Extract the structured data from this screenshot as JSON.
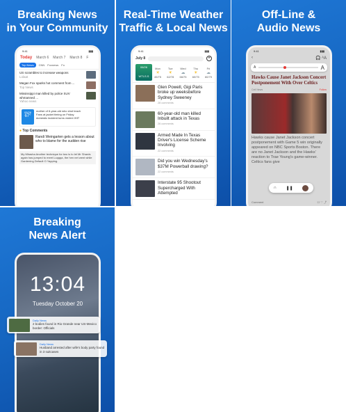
{
  "panels": {
    "p1": {
      "title_line1": "Breaking News",
      "title_line2": "in Your Community",
      "dates": [
        "Today",
        "March 6",
        "March 7",
        "March 8",
        "F"
      ],
      "sources": [
        "Top News",
        "CNN",
        "Foxnews",
        "Fo"
      ],
      "news": [
        {
          "title": "US scrambles to increase weapons",
          "meta": "Lolaat"
        },
        {
          "title": "Megan Fox sparks hot comment from ...",
          "meta": "Top News"
        },
        {
          "title": "Mississippi man killed by police SUV whmanned ...",
          "meta": "Yahoo news"
        }
      ],
      "weather_bullets": [
        "mother of 6-year-old who shot teach",
        "Fans at jacket timing on Friday",
        "domestic incident turns violent IHIT"
      ],
      "weather_card": {
        "date": "05/26",
        "temp": "67°"
      },
      "top_comments_label": "Top Comments",
      "comment_title": "Randi Weingarten gets a lesson about who to blame for the sudden rise",
      "quote": "My Mhasha Another technique for two is to let Mr Shards again has jumped to meet Luqqqa, the hen net went while Gardening Default O Yapping."
    },
    "p2": {
      "title_line1": "Real-Time Weather",
      "title_line2": "Traffic & Local News",
      "date": "July 8",
      "weather_card": {
        "date": "06/26",
        "label": "WTLS.S"
      },
      "days": [
        "Mon",
        "Tue",
        "Wed",
        "Thu",
        "Fri"
      ],
      "temps": [
        "45/75",
        "62/78",
        "66/75",
        "60/75",
        "60/79"
      ],
      "news": [
        {
          "title": "Glen Powell, Gigi Paris broke up weeksbefore Sydney Sweeney",
          "meta": "28 comments"
        },
        {
          "title": "60-year-old man killed Inbuilt attack in Texas",
          "meta": "26 comments"
        },
        {
          "title": "Armed Made In Texas Driver's License Scheme Involving",
          "meta": "22 comments"
        },
        {
          "title": "Did you win Wednesday's $37M Powerball drawing?",
          "meta": "22 comments"
        },
        {
          "title": "Interstate 95 Shootout Supercharged With Attempted",
          "meta": ""
        }
      ]
    },
    "p3": {
      "title_line1": "Off-Line &",
      "title_line2": "Audio News",
      "font_small": "A",
      "font_large": "A",
      "headline": "Hawks Cause Janet Jackson Concert Postponement With Over Celtics",
      "byline": "Cell News",
      "follow": "Follow",
      "body": "Hawks cause Janet Jackson concert postponement with Game 5 win originally appeared on NBC Sports Boston. There are no Janet Jackson and the Hawks' reaction to Trae Young's game-winner. Celtics fans give",
      "footer_comment": "Comment"
    },
    "p4": {
      "title_line1": "Breaking",
      "title_line2": "News Alert",
      "time": "13:04",
      "date": "Tuesday October 20",
      "notifications": [
        {
          "app": "Daily News",
          "text": "2 bodies found in Rio Grande near US-Mexico border: Officials"
        },
        {
          "app": "Daily News",
          "text": "Husband arrested after wife's body party found in 3 suitcases"
        }
      ]
    }
  },
  "colors": {
    "brand": "#1565c0",
    "accent": "#e53935"
  }
}
